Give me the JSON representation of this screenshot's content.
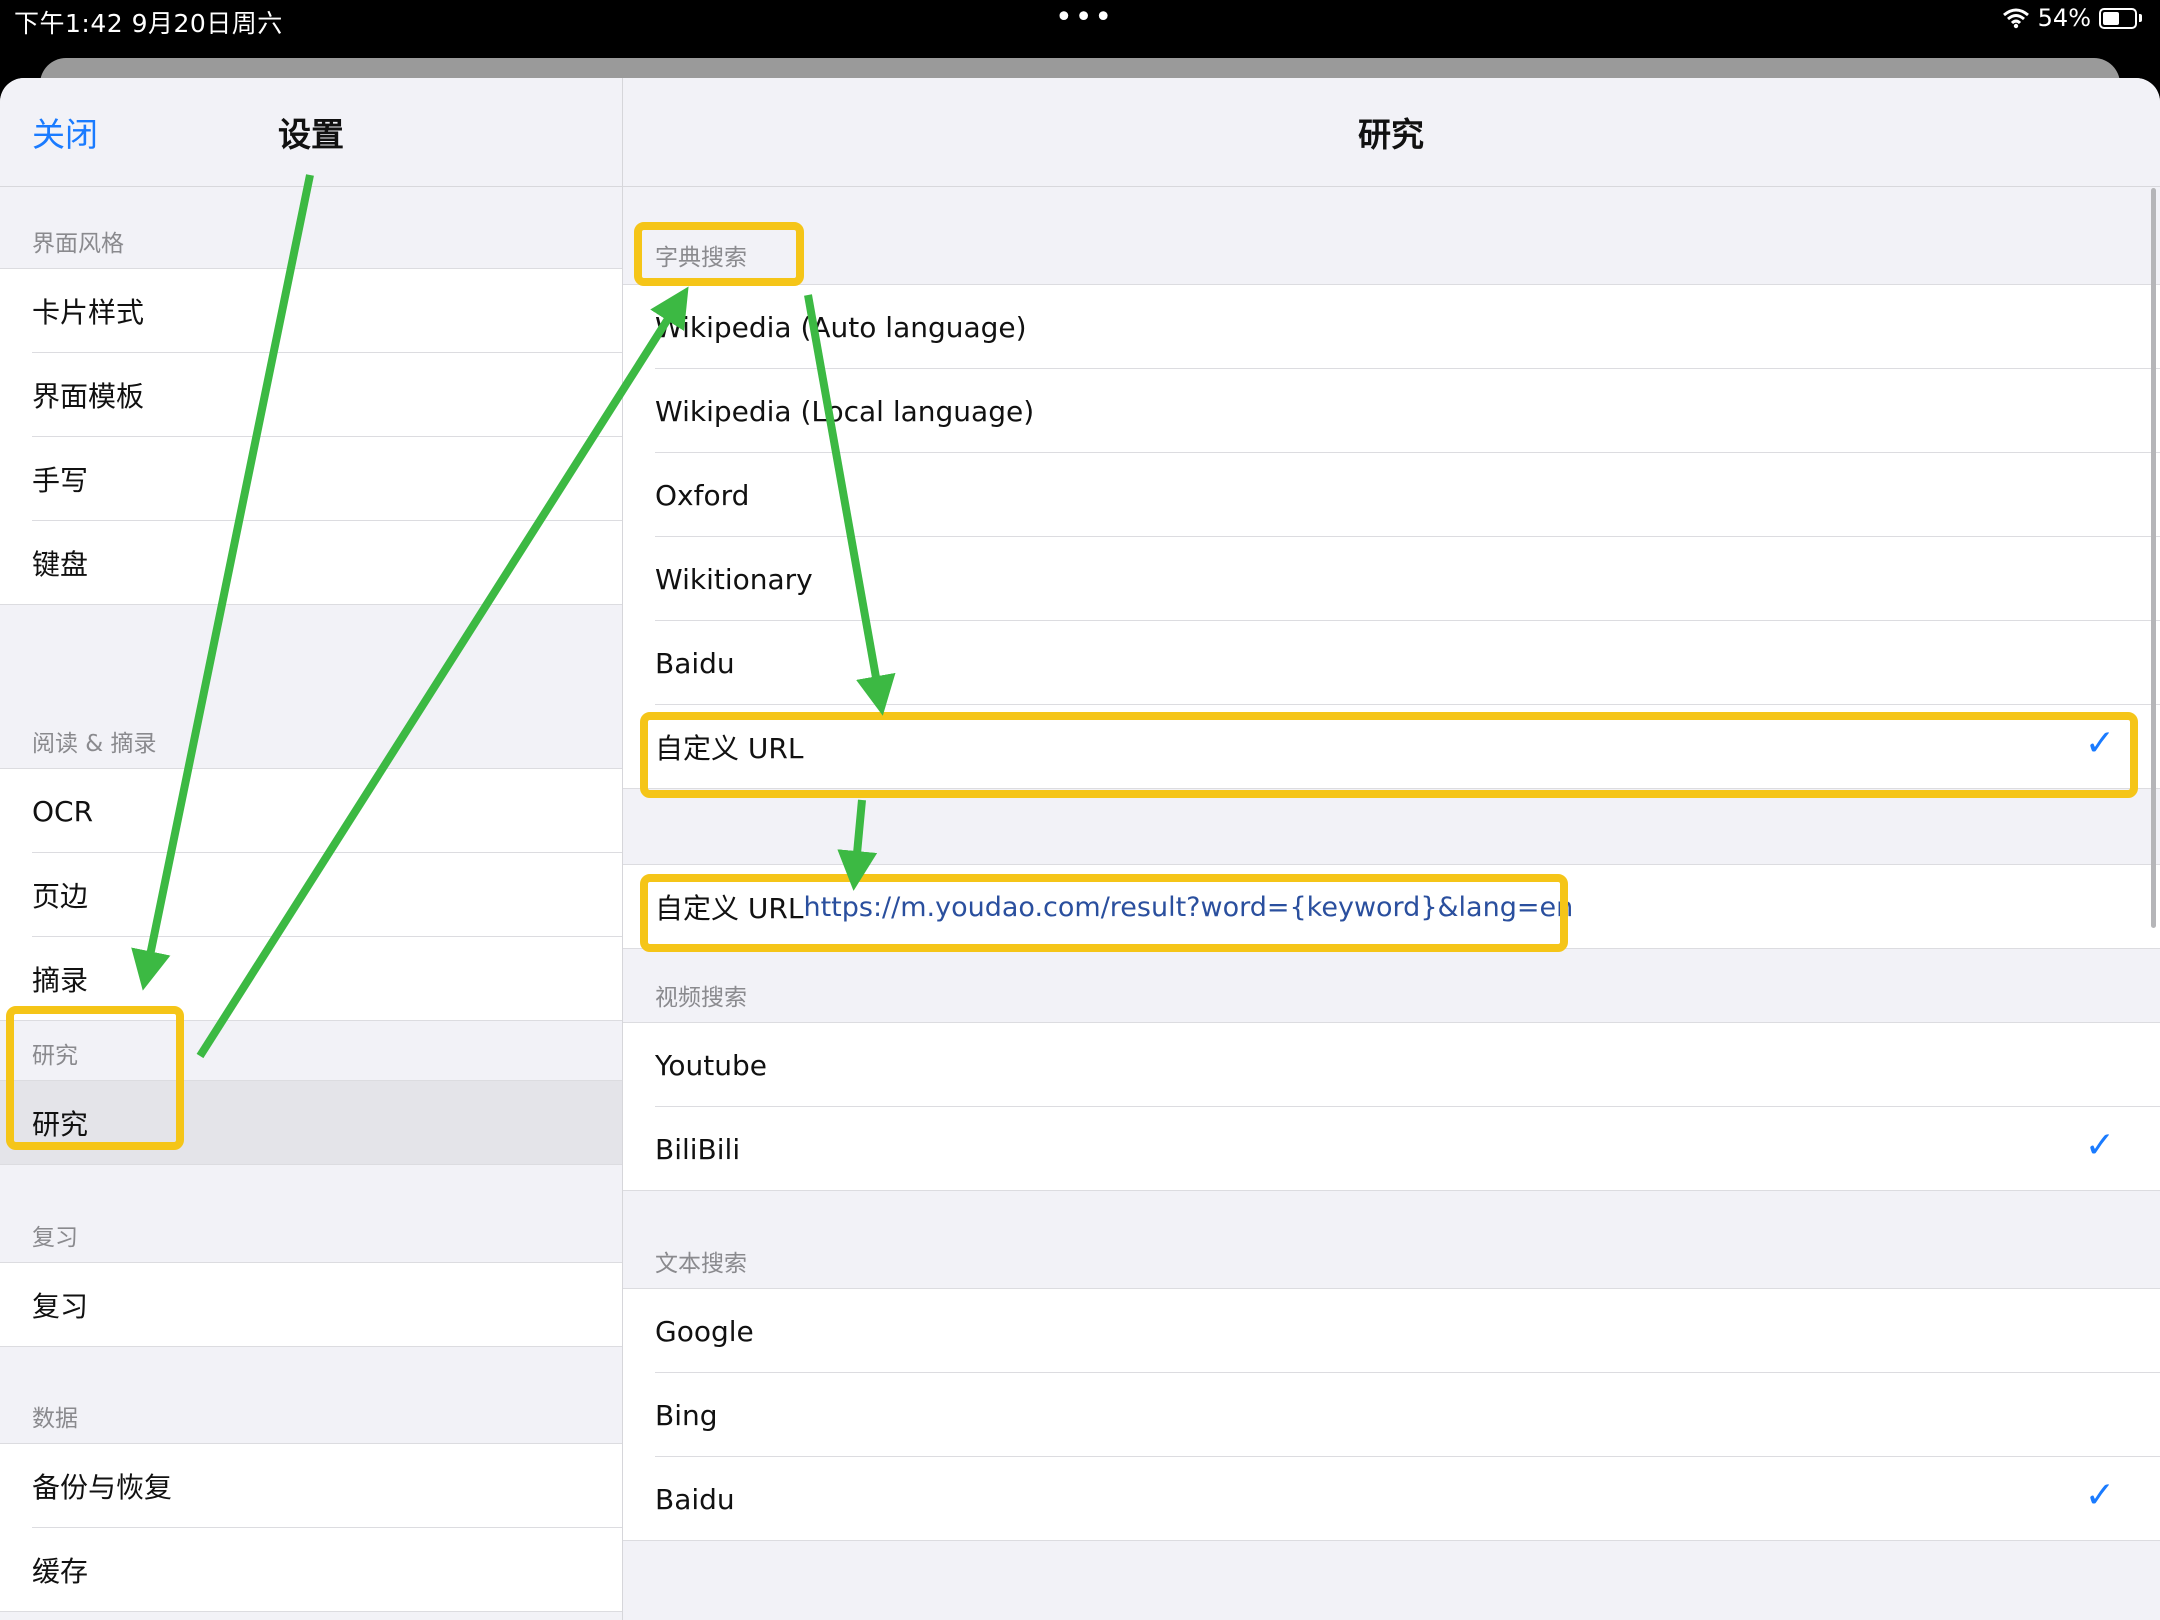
{
  "status_bar": {
    "time_date": "下午1:42   9月20日周六",
    "dots": "•••",
    "battery_text": "54%",
    "battery_level": 0.54
  },
  "left_panel": {
    "close_label": "关闭",
    "title": "设置",
    "sections": [
      {
        "header": "界面风格",
        "items": [
          "卡片样式",
          "界面模板",
          "手写",
          "键盘"
        ]
      },
      {
        "header": "阅读 & 摘录",
        "items": [
          "OCR",
          "页边",
          "摘录"
        ]
      },
      {
        "header": "研究",
        "items": [
          "研究"
        ],
        "selected_item": "研究"
      },
      {
        "header": "复习",
        "items": [
          "复习"
        ]
      },
      {
        "header": "数据",
        "items": [
          "备份与恢复",
          "缓存"
        ]
      }
    ]
  },
  "right_panel": {
    "title": "研究",
    "dictionary": {
      "header": "字典搜索",
      "items": [
        {
          "label": "Wikipedia (Auto language)",
          "checked": false
        },
        {
          "label": "Wikipedia (Local language)",
          "checked": false
        },
        {
          "label": "Oxford",
          "checked": false
        },
        {
          "label": "Wikitionary",
          "checked": false
        },
        {
          "label": "Baidu",
          "checked": false
        },
        {
          "label": "自定义 URL",
          "checked": true
        }
      ]
    },
    "custom_url": {
      "label": "自定义 URL",
      "value": "https://m.youdao.com/result?word={keyword}&lang=en"
    },
    "video": {
      "header": "视频搜索",
      "items": [
        {
          "label": "Youtube",
          "checked": false
        },
        {
          "label": "BiliBili",
          "checked": true
        }
      ]
    },
    "text": {
      "header": "文本搜索",
      "items": [
        {
          "label": "Google",
          "checked": false
        },
        {
          "label": "Bing",
          "checked": false
        },
        {
          "label": "Baidu",
          "checked": true
        }
      ]
    }
  },
  "colors": {
    "accent": "#1a7bff",
    "highlight_box": "#f5c518",
    "annotation_arrow": "#3cb943"
  },
  "icons": {
    "checkmark": "✓",
    "wifi": "wifi-icon",
    "battery": "battery-icon"
  }
}
